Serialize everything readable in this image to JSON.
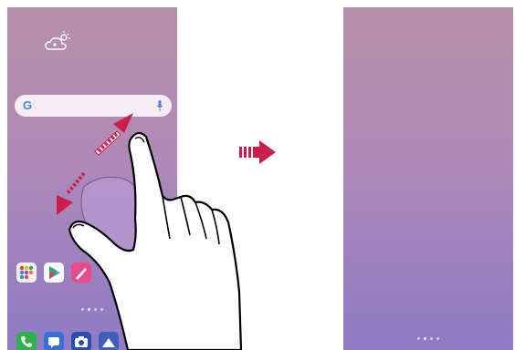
{
  "search": {
    "logo": "G",
    "mic_icon": "mic-icon"
  },
  "weather": {
    "icon": "partly-cloudy-icon"
  },
  "home_apps": [
    {
      "name": "apps-folder-icon",
      "color": "#f2f2f2"
    },
    {
      "name": "play-store-icon",
      "color": "#ffffff"
    },
    {
      "name": "pen-app-icon",
      "color": "#e84a8a"
    }
  ],
  "dock_apps": [
    {
      "name": "phone-icon",
      "color": "#2fb24c"
    },
    {
      "name": "messages-icon",
      "color": "#3a6fd8"
    },
    {
      "name": "camera-icon",
      "color": "#2b4fa8"
    },
    {
      "name": "gallery-icon",
      "color": "#3f5fb8"
    }
  ],
  "colors": {
    "arrow": "#cc1e4a",
    "pinch_zone": "#b89ad0"
  }
}
